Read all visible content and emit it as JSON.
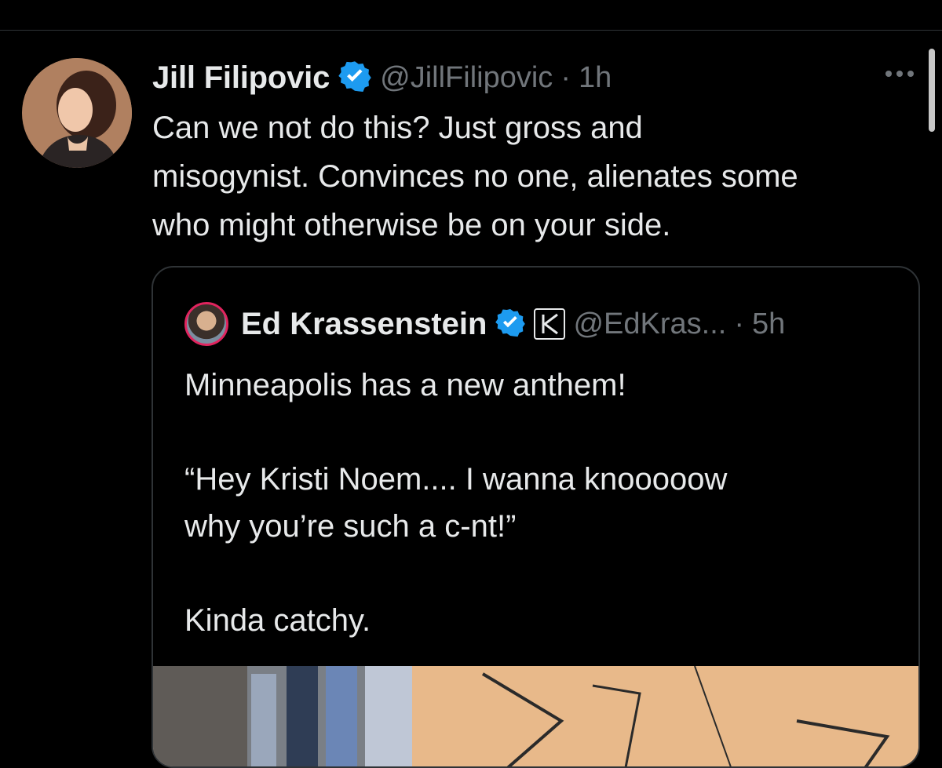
{
  "colors": {
    "background": "#000000",
    "text_primary": "#e7e9ea",
    "text_secondary": "#71767b",
    "divider": "#2f3336",
    "verified_blue": "#1d9bf0"
  },
  "tweet": {
    "author": {
      "name": "Jill Filipovic",
      "handle": "@JillFilipovic",
      "verified_icon": "verified-badge"
    },
    "separator": "·",
    "time": "1h",
    "more_icon": "more-horizontal",
    "text": "Can we not do this? Just gross and\nmisogynist. Convinces no one, alienates some\nwho might otherwise be on your side."
  },
  "quote": {
    "author": {
      "name": "Ed Krassenstein",
      "handle": "@EdKras...",
      "verified_icon": "verified-badge",
      "affiliate_badge": "K"
    },
    "separator": "·",
    "time": "5h",
    "text": "Minneapolis has a new anthem!\n\n“Hey Kristi Noem.... I wanna knooooow\nwhy you’re such a c-nt!”\n\nKinda catchy."
  }
}
